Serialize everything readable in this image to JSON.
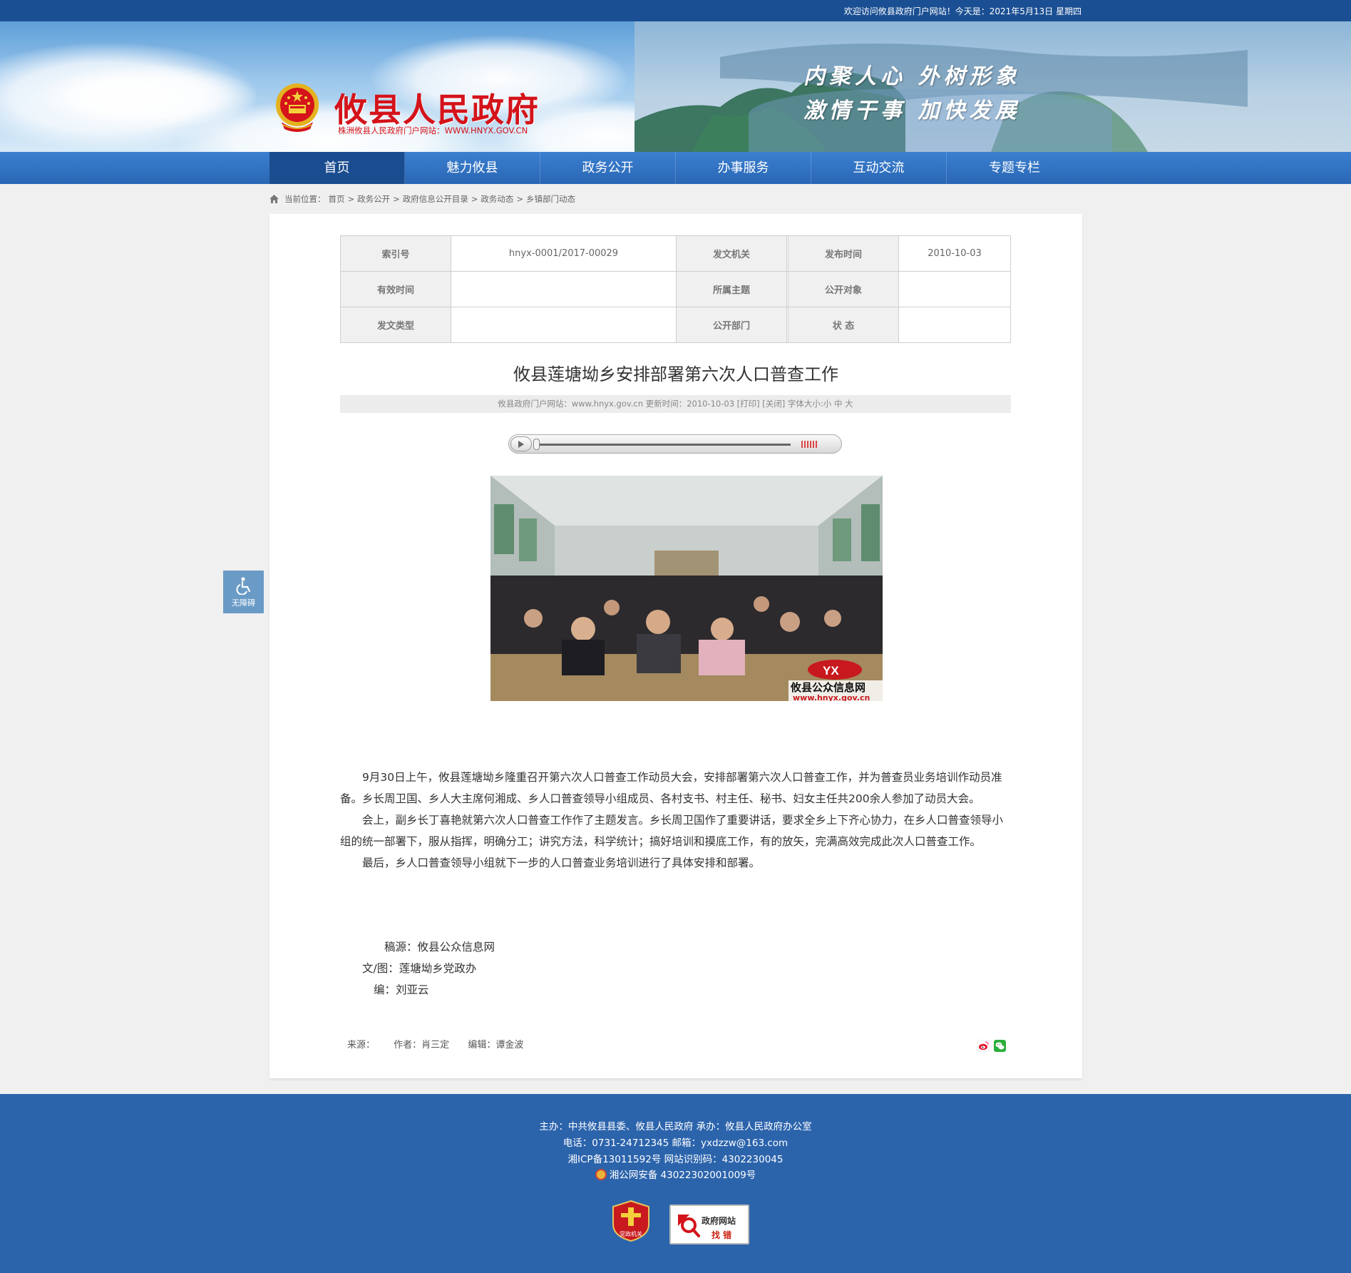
{
  "topbar": {
    "welcome": "欢迎访问攸县政府门户网站！今天是：2021年5月13日 星期四"
  },
  "header": {
    "site_title": "攸县人民政府",
    "site_subtitle": "株洲攸县人民政府门户网站：WWW.HNYX.GOV.CN",
    "slogan_line1": "内聚人心  外树形象",
    "slogan_line2": "激情干事  加快发展",
    "emblem_icon": "national-emblem-icon"
  },
  "nav": {
    "items": [
      {
        "label": "首页",
        "active": true
      },
      {
        "label": "魅力攸县"
      },
      {
        "label": "政务公开"
      },
      {
        "label": "办事服务"
      },
      {
        "label": "互动交流"
      },
      {
        "label": "专题专栏"
      }
    ]
  },
  "breadcrumb": {
    "prefix": "当前位置：",
    "items": [
      "首页",
      "政务公开",
      "政府信息公开目录",
      "政务动态",
      "乡镇部门动态"
    ],
    "separator": ">"
  },
  "info_table": {
    "rows": [
      [
        {
          "k": "索引号"
        },
        {
          "v": "hnyx-0001/2017-00029"
        },
        {
          "k": "发文机关"
        },
        {
          "v": ""
        },
        {
          "k": "发布时间"
        },
        {
          "v": "2010-10-03"
        }
      ],
      [
        {
          "k": "有效时间"
        },
        {
          "v": ""
        },
        {
          "k": "所属主题"
        },
        {
          "v": ""
        },
        {
          "k": "公开对象"
        },
        {
          "v": ""
        }
      ],
      [
        {
          "k": "发文类型"
        },
        {
          "v": ""
        },
        {
          "k": "公开部门"
        },
        {
          "v": ""
        },
        {
          "k": "状 态"
        },
        {
          "v": ""
        }
      ]
    ]
  },
  "article": {
    "title": "攸县莲塘坳乡安排部署第六次人口普查工作",
    "meta": "攸县政府门户网站：www.hnyx.gov.cn   更新时间：2010-10-03  [打印] [关闭]  字体大小:小 中 大",
    "photo_watermark_logo": "YX",
    "photo_watermark_text": "攸县公众信息网",
    "photo_watermark_url": "www.hnyx.gov.cn",
    "paragraphs": [
      "9月30日上午，攸县莲塘坳乡隆重召开第六次人口普查工作动员大会，安排部署第六次人口普查工作，并为普查员业务培训作动员准备。乡长周卫国、乡人大主席何湘成、乡人口普查领导小组成员、各村支书、村主任、秘书、妇女主任共200余人参加了动员大会。",
      "会上，副乡长丁喜艳就第六次人口普查工作作了主题发言。乡长周卫国作了重要讲话，要求全乡上下齐心协力，在乡人口普查领导小组的统一部署下，服从指挥，明确分工；讲究方法，科学统计；搞好培训和摸底工作，有的放矢，完满高效完成此次人口普查工作。",
      "最后，乡人口普查领导小组就下一步的人口普查业务培训进行了具体安排和部署。"
    ],
    "credits": [
      "      稿源：攸县公众信息网",
      "   文/图：莲塘坳乡党政办",
      "      编：刘亚云"
    ],
    "source_label": "来源：",
    "author": "作者：肖三定",
    "editor": "编辑：谭金波"
  },
  "side": {
    "a11y_label": "无障碍"
  },
  "footer": {
    "line1": "主办：中共攸县县委、攸县人民政府 承办：攸县人民政府办公室",
    "line2": "电话：0731-24712345 邮箱：yxdzzw@163.com",
    "line3": "湘ICP备13011592号    网站识别码：4302230045",
    "line4": "湘公网安备 43022302001009号",
    "party_badge_label": "党政机关",
    "error_badge_line1": "政府网站",
    "error_badge_line2": "找 错"
  },
  "colors": {
    "topbar": "#1b4f93",
    "nav": "#2a67b5",
    "nav_active": "#1a4d8f",
    "title_red": "#d4131a",
    "footer": "#2c64ac"
  }
}
